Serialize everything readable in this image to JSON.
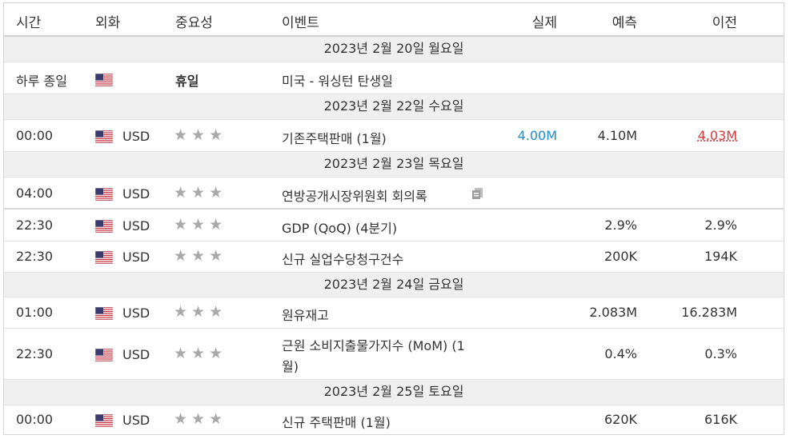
{
  "header": {
    "time": "시간",
    "currency": "외화",
    "importance": "중요성",
    "event": "이벤트",
    "actual": "실제",
    "forecast": "예측",
    "previous": "이전"
  },
  "dates": {
    "d20": "2023년 2월 20일 월요일",
    "d22": "2023년 2월 22일 수요일",
    "d23": "2023년 2월 23일 목요일",
    "d24": "2023년 2월 24일 금요일",
    "d25": "2023년 2월 25일 토요일"
  },
  "events": [
    {
      "time": "하루 종일",
      "currency": "",
      "importance": "휴일",
      "event": "미국 - 워싱턴 탄생일",
      "actual": "",
      "forecast": "",
      "previous": ""
    },
    {
      "time": "00:00",
      "currency": "USD",
      "event": "기존주택판매 (1월)",
      "actual": "4.00M",
      "forecast": "4.10M",
      "previous": "4.03M"
    },
    {
      "time": "04:00",
      "currency": "USD",
      "event": "연방공개시장위원회 회의록",
      "actual": "",
      "forecast": "",
      "previous": ""
    },
    {
      "time": "22:30",
      "currency": "USD",
      "event": "GDP (QoQ) (4분기)",
      "actual": "",
      "forecast": "2.9%",
      "previous": "2.9%"
    },
    {
      "time": "22:30",
      "currency": "USD",
      "event": "신규 실업수당청구건수",
      "actual": "",
      "forecast": "200K",
      "previous": "194K"
    },
    {
      "time": "01:00",
      "currency": "USD",
      "event": "원유재고",
      "actual": "",
      "forecast": "2.083M",
      "previous": "16.283M"
    },
    {
      "time": "22:30",
      "currency": "USD",
      "event_line1": "근원 소비지출물가지수 (MoM) (1",
      "event_line2": "월)",
      "actual": "",
      "forecast": "0.4%",
      "previous": "0.3%"
    },
    {
      "time": "00:00",
      "currency": "USD",
      "event": "신규 주택판매 (1월)",
      "actual": "",
      "forecast": "620K",
      "previous": "616K"
    }
  ],
  "colors": {
    "actual_better": "#1d8bd1",
    "previous_worse": "#d83a3a",
    "star": "#a9a9a9"
  },
  "icons": {
    "importance_star": "★",
    "flag": "us-flag-icon",
    "document": "document-icon"
  }
}
